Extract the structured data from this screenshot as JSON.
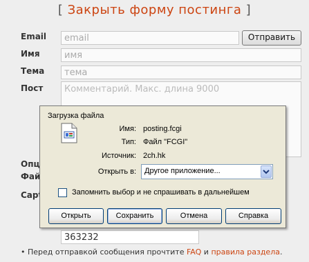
{
  "form": {
    "bracket_open": "[",
    "title": "Закрыть форму постинга",
    "bracket_close": "]",
    "labels": {
      "email": "Email",
      "name": "Имя",
      "subject": "Тема",
      "post": "Пост",
      "options_partial": "Опци",
      "file_partial": "Фай",
      "captcha_partial": "Capt"
    },
    "email_placeholder": "email",
    "name_placeholder": "имя",
    "subject_placeholder": "тема",
    "comment_placeholder": "Комментарий. Макс. длина 9000",
    "submit_label": "Отправить",
    "captcha_value": "363232",
    "rules_bullet": "•",
    "rules_prefix": "Перед отправкой сообщения прочтите",
    "rules_faq": "FAQ",
    "rules_and": "и",
    "rules_link": "правила раздела",
    "rules_dot": "."
  },
  "dialog": {
    "title": "Загрузка файла",
    "icon": "file-icon",
    "name_label": "Имя:",
    "name_value": "posting.fcgi",
    "type_label": "Тип:",
    "type_value": "Файл \"FCGI\"",
    "source_label": "Источник:",
    "source_value": "2ch.hk",
    "open_in_label": "Открыть в:",
    "open_in_value": "Другое приложение...",
    "remember_label": "Запомнить выбор и не спрашивать в дальнейшем",
    "remember_checked": false,
    "buttons": {
      "open": "Открыть",
      "save": "Сохранить",
      "cancel": "Отмена",
      "help": "Справка"
    }
  },
  "colors": {
    "accent": "#cc4411",
    "dialog_bg": "#ece9d8",
    "page_bg": "#eeeeee"
  }
}
